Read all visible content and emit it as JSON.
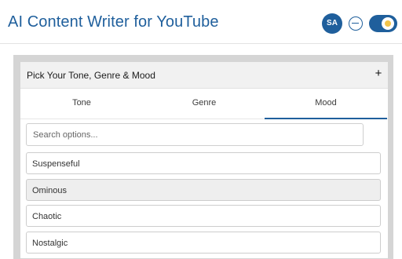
{
  "app": {
    "title": "AI Content Writer for YouTube",
    "avatar_initials": "SA",
    "accent_color": "#1f5f9c",
    "toggle_on": true
  },
  "panel": {
    "title": "Pick Your Tone, Genre & Mood",
    "expand_icon": "plus-icon",
    "tabs": [
      {
        "label": "Tone",
        "active": false
      },
      {
        "label": "Genre",
        "active": false
      },
      {
        "label": "Mood",
        "active": true
      }
    ],
    "search": {
      "placeholder": "Search options...",
      "value": ""
    },
    "options": [
      {
        "label": "Suspenseful",
        "highlighted": false
      },
      {
        "label": "Ominous",
        "highlighted": true
      },
      {
        "label": "Chaotic",
        "highlighted": false
      },
      {
        "label": "Nostalgic",
        "highlighted": false
      }
    ]
  }
}
